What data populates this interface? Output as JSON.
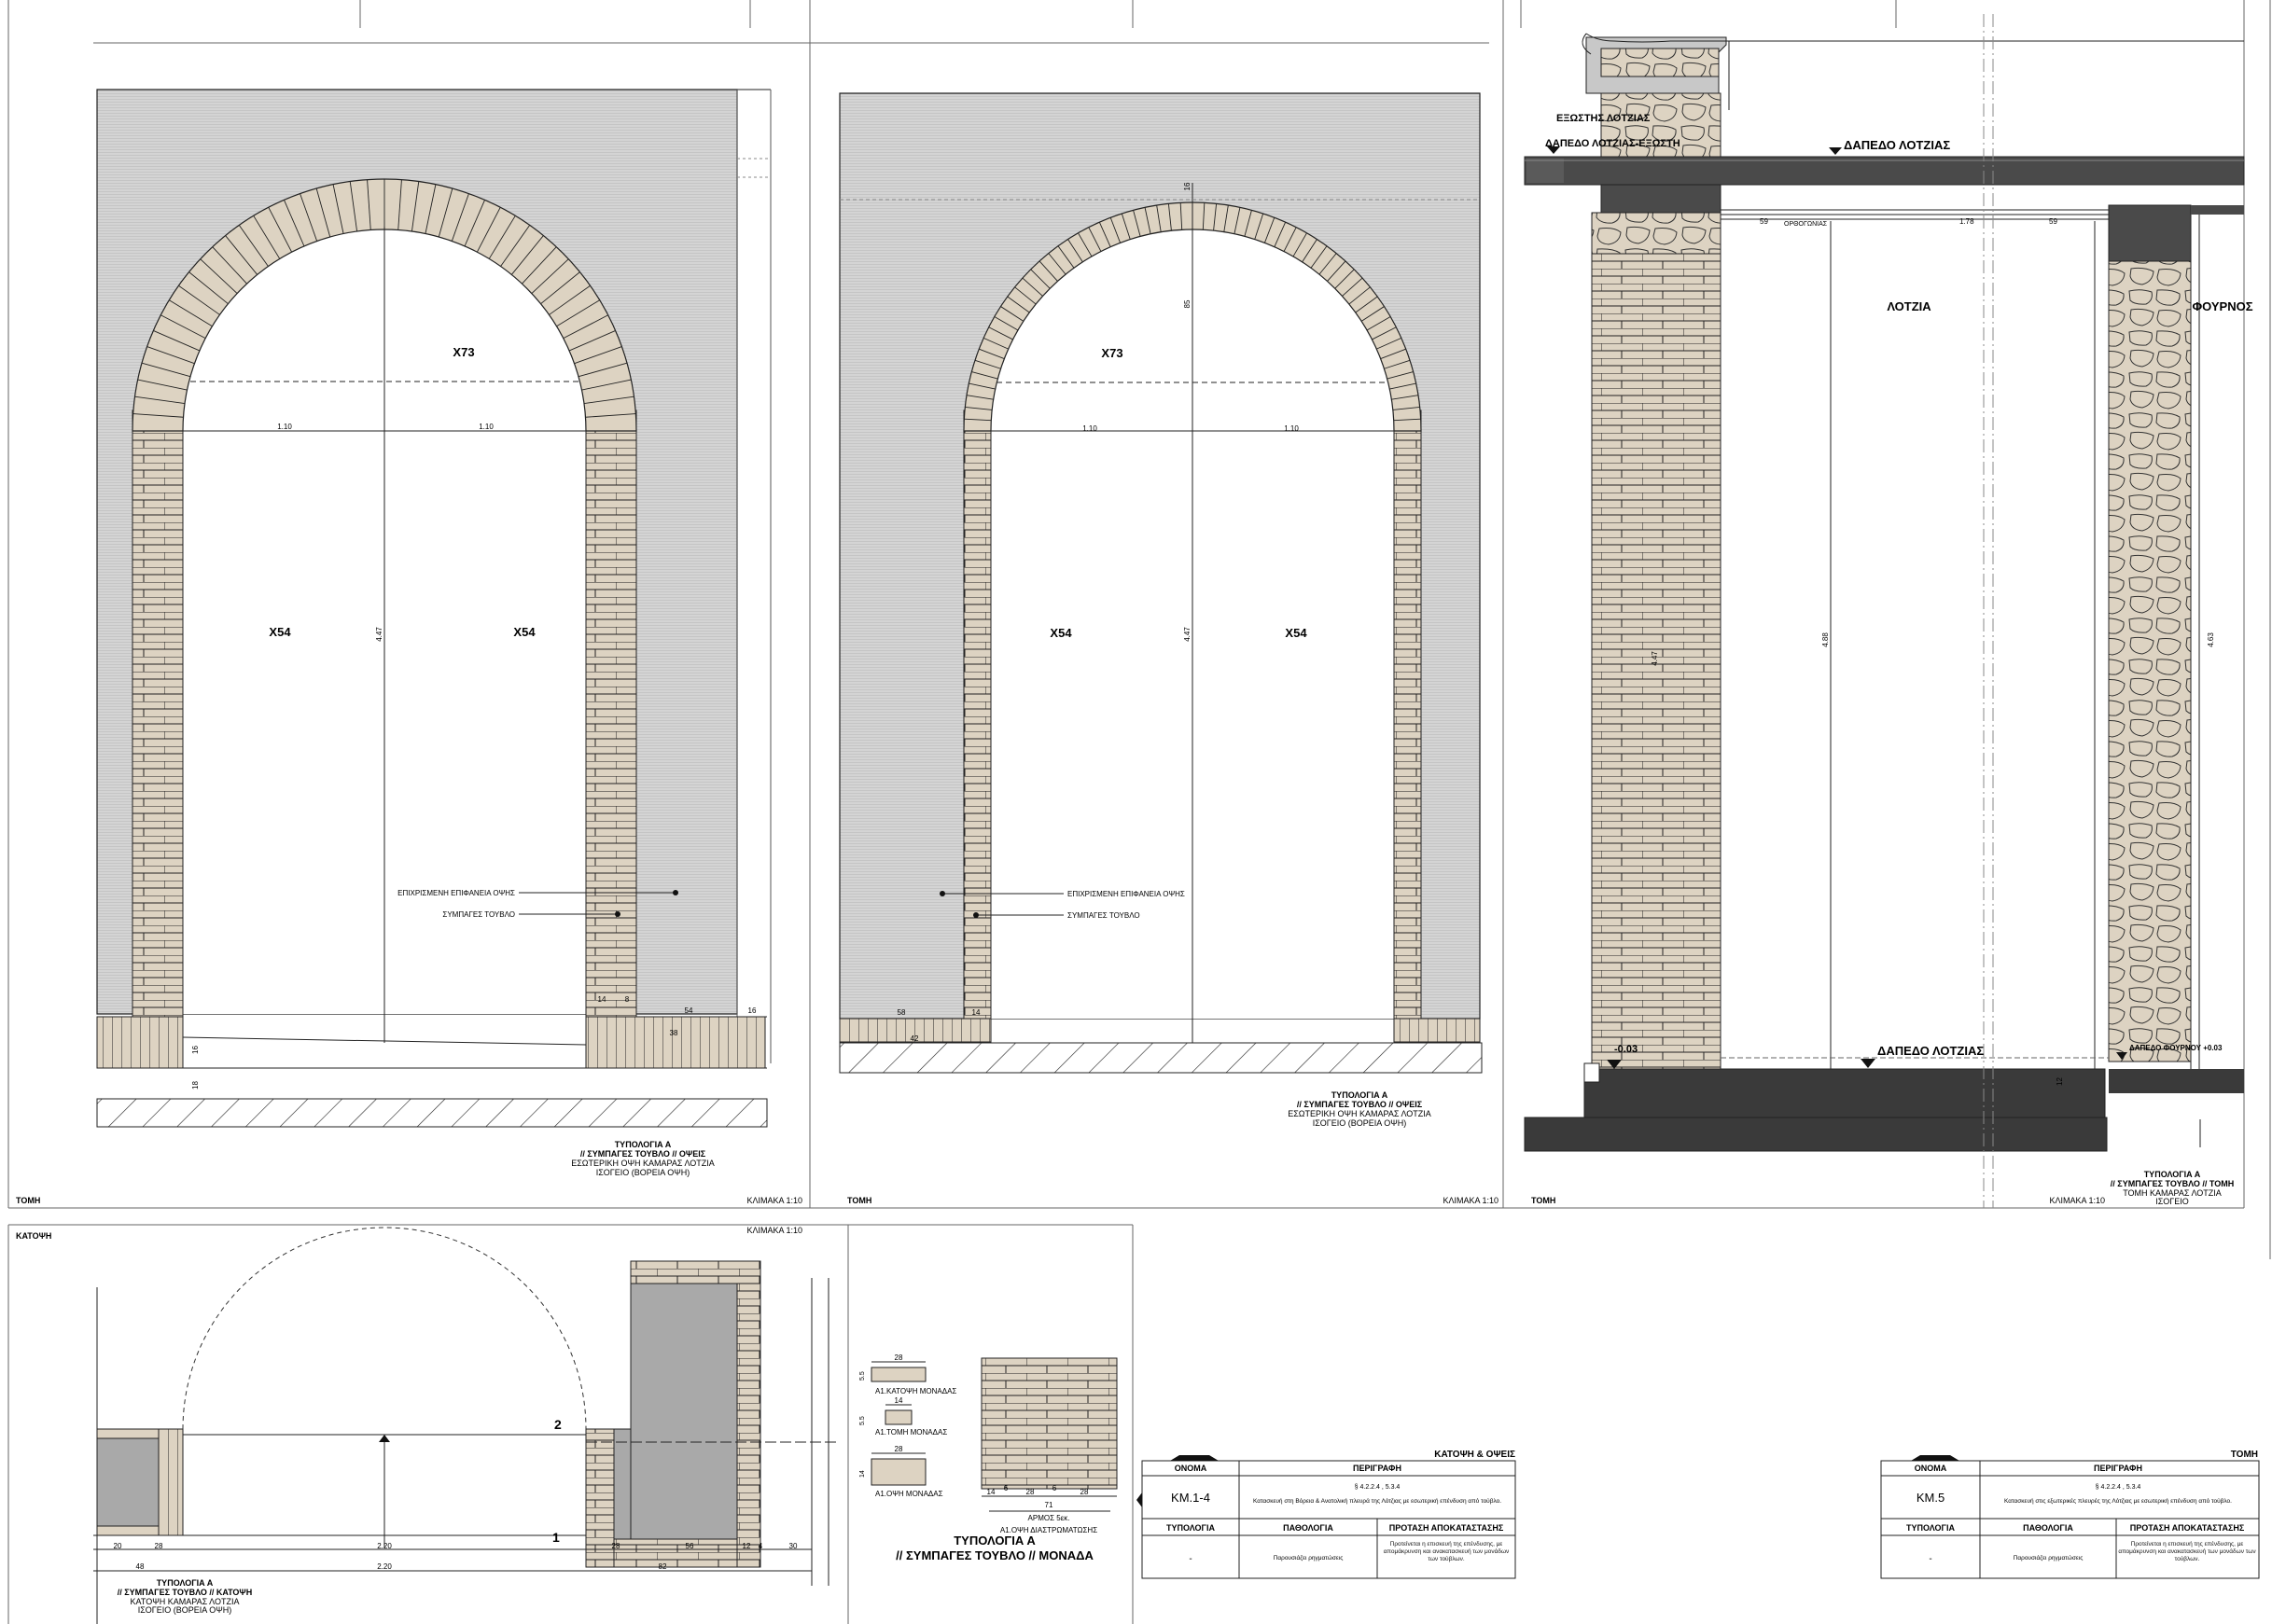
{
  "panels": {
    "elev1": {
      "label_left": "ΤΟΜΗ",
      "scale": "ΚΛΙΜΑΚΑ 1:10",
      "title": [
        "ΤΥΠΟΛΟΓΙΑ Α",
        "// ΣΥΜΠΑΓΕΣ ΤΟΥΒΛΟ // ΟΨΕΙΣ",
        "ΕΣΩΤΕΡΙΚΗ ΟΨΗ ΚΑΜΑΡΑΣ ΛΟΤΖΙΑ",
        "ΙΣΟΓΕΙΟ (ΒΟΡΕΙΑ ΟΨΗ)"
      ],
      "tags": {
        "x73": "X73",
        "x54a": "X54",
        "x54b": "X54"
      },
      "dims": {
        "span_l": "1.10",
        "span_r": "1.10",
        "height": "4.47",
        "d54": "54",
        "d16": "16",
        "d38": "38",
        "d16b": "16",
        "d18": "18",
        "d14": "14",
        "d8": "8"
      },
      "callouts": {
        "render": "ΕΠΙΧΡΙΣΜΕΝΗ ΕΠΙΦΑΝΕΙΑ ΟΨΗΣ",
        "brick": "ΣΥΜΠΑΓΕΣ ΤΟΥΒΛΟ"
      }
    },
    "elev2": {
      "label_left": "ΤΟΜΗ",
      "scale": "ΚΛΙΜΑΚΑ 1:10",
      "title": [
        "ΤΥΠΟΛΟΓΙΑ Α",
        "// ΣΥΜΠΑΓΕΣ ΤΟΥΒΛΟ // ΟΨΕΙΣ",
        "ΕΣΩΤΕΡΙΚΗ ΟΨΗ ΚΑΜΑΡΑΣ ΛΟΤΖΙΑ",
        "ΙΣΟΓΕΙΟ (ΒΟΡΕΙΑ ΟΨΗ)"
      ],
      "tags": {
        "x73": "X73",
        "x54a": "X54",
        "x54b": "X54"
      },
      "dims": {
        "span_l": "1.10",
        "span_r": "1.10",
        "height": "4.47",
        "crown": "85",
        "key": "16",
        "d58": "58",
        "d14": "14",
        "d42": "42"
      },
      "callouts": {
        "render": "ΕΠΙΧΡΙΣΜΕΝΗ ΕΠΙΦΑΝΕΙΑ ΟΨΗΣ",
        "brick": "ΣΥΜΠΑΓΕΣ ΤΟΥΒΛΟ"
      }
    },
    "section": {
      "label_left": "ΤΟΜΗ",
      "scale": "ΚΛΙΜΑΚΑ 1:10",
      "title": [
        "ΤΥΠΟΛΟΓΙΑ Α",
        "// ΣΥΜΠΑΓΕΣ ΤΟΥΒΛΟ // ΤΟΜΗ",
        "ΤΟΜΗ ΚΑΜΑΡΑΣ ΛΟΤΖΙΑ",
        "ΙΣΟΓΕΙΟ"
      ],
      "labels": {
        "ext_loggia": "ΕΞΩΣΤΗΣ ΛΟΤΖΙΑΣ",
        "floor_ext": "ΔΑΠΕΔΟ ΛΟΤΖΙΑΣ-ΕΞΩΣΤΗ",
        "floor_top": "ΔΑΠΕΔΟ ΛΟΤΖΙΑΣ",
        "loggia": "ΛΟΤΖΙΑ",
        "oven": "ΦΟΥΡΝΟΣ",
        "floor_bottom": "ΔΑΠΕΔΟ ΛΟΤΖΙΑΣ",
        "oven_floor": "ΔΑΠΕΔΟ ΦΟΥΡΝΟΥ +0.03",
        "level": "-0.03",
        "beam": "ΟΡΘΟΓΩΝΙΑΣ"
      },
      "dims": {
        "h1": "4.47",
        "h2": "4.88",
        "h3": "4.63",
        "d59a": "59",
        "d178": "1.78",
        "d59b": "59",
        "d12": "12"
      }
    },
    "plan": {
      "label_left": "ΚΑΤΟΨΗ",
      "scale": "ΚΛΙΜΑΚΑ 1:10",
      "title": [
        "ΤΥΠΟΛΟΓΙΑ Α",
        "// ΣΥΜΠΑΓΕΣ ΤΟΥΒΛΟ // ΚΑΤΟΨΗ",
        "ΚΑΤΟΨΗ ΚΑΜΑΡΑΣ ΛΟΤΖΙΑ",
        "ΙΣΟΓΕΙΟ (ΒΟΡΕΙΑ ΟΨΗ)"
      ],
      "marks": {
        "m1": "1",
        "m2": "2"
      },
      "dims": {
        "d20": "20",
        "d28a": "28",
        "d220a": "2.20",
        "d28b": "28",
        "d56": "56",
        "d12": "12",
        "d4": "4",
        "d30": "30",
        "d48": "48",
        "d220b": "2.20",
        "d82": "82"
      }
    },
    "unit": {
      "title": [
        "ΤΥΠΟΛΟΓΙΑ Α",
        "// ΣΥΜΠΑΓΕΣ ΤΟΥΒΛΟ // ΜΟΝΑΔΑ"
      ],
      "items": {
        "plan_label": "Α1.ΚΑΤΟΨΗ ΜΟΝΑΔΑΣ",
        "section_label": "Α1.ΤΟΜΗ ΜΟΝΑΔΑΣ",
        "elev_label": "Α1.ΟΨΗ ΜΟΝΑΔΑΣ",
        "bond_label": "Α1.ΟΨΗ ΔΙΑΣΤΡΩΜΑΤΩΣΗΣ",
        "joint_label": "ΑΡΜΟΣ 5εκ."
      },
      "dims": {
        "w28a": "28",
        "h55": "5.5",
        "w14": "14",
        "h55b": "5.5",
        "w28b": "28",
        "h14": "14",
        "b14": "14",
        "b28a": "28",
        "b28b": "28",
        "b71": "71",
        "b6a": "6",
        "b6b": "6"
      }
    }
  },
  "tables": {
    "t1": {
      "heading": "ΚΑΤΟΨΗ & ΟΨΕΙΣ",
      "h_name": "ΟΝΟΜΑ",
      "h_desc": "ΠΕΡΙΓΡΑΦΗ",
      "name": "ΚΜ.1-4",
      "ref": "§ 4.2.2.4 , 5.3.4",
      "desc": "Κατασκευή στη Βόρεια & Ανατολική πλευρά της Λότζιας με εσωτερική επένδυση από τούβλο.",
      "h_type": "ΤΥΠΟΛΟΓΙΑ",
      "h_path": "ΠΑΘΟΛΟΓΙΑ",
      "h_prop": "ΠΡΟΤΑΣΗ ΑΠΟΚΑΤΑΣΤΑΣΗΣ",
      "type": "-",
      "path": "Παρουσιάζει ρηγματώσεις",
      "prop": "Προτείνεται η επισκευή της επένδυσης, με απομάκρυνση και ανακατασκευή των μονάδων των τούβλων."
    },
    "t2": {
      "heading": "ΤΟΜΗ",
      "h_name": "ΟΝΟΜΑ",
      "h_desc": "ΠΕΡΙΓΡΑΦΗ",
      "name": "ΚΜ.5",
      "ref": "§ 4.2.2.4 , 5.3.4",
      "desc": "Κατασκευή στις εξωτερικές πλευρές της Λότζιας με εσωτερική επένδυση από τούβλο.",
      "h_type": "ΤΥΠΟΛΟΓΙΑ",
      "h_path": "ΠΑΘΟΛΟΓΙΑ",
      "h_prop": "ΠΡΟΤΑΣΗ ΑΠΟΚΑΤΑΣΤΑΣΗΣ",
      "type": "-",
      "path": "Παρουσιάζει ρηγματώσεις",
      "prop": "Προτείνεται η επισκευή της επένδυσης, με απομάκρυνση και ανακατασκευή των μονάδων των τούβλων."
    }
  }
}
